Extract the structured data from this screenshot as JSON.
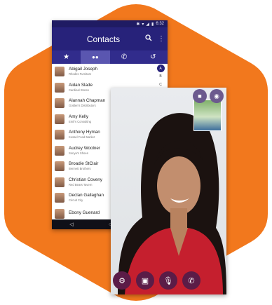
{
  "status": {
    "time": "6:32",
    "icons": [
      "bluetooth-icon",
      "wifi-icon",
      "signal-icon",
      "battery-icon"
    ]
  },
  "appbar": {
    "title": "Contacts",
    "search_icon": "search-icon",
    "menu_icon": "more-vert-icon"
  },
  "tabs": [
    {
      "icon": "star-icon",
      "glyph": "★"
    },
    {
      "icon": "contacts-icon",
      "glyph": "👥"
    },
    {
      "icon": "phone-icon",
      "glyph": "✆"
    },
    {
      "icon": "history-icon",
      "glyph": "↺"
    }
  ],
  "index_letters": [
    "A",
    "B",
    "C"
  ],
  "contacts": [
    {
      "name": "Abigail Joseph",
      "company": "Rhodes Furniture"
    },
    {
      "name": "Aidan Slade",
      "company": "Cardinal Stores"
    },
    {
      "name": "Alannah Chapman",
      "company": "Golden's Distributors"
    },
    {
      "name": "Amy Kelly",
      "company": "Emil's Consulting"
    },
    {
      "name": "Anthony Hyman",
      "company": "Kessel Food Market"
    },
    {
      "name": "Audrey Woolner",
      "company": "Sonya's Shoes"
    },
    {
      "name": "Broadie StClair",
      "company": "Bennett Brothers"
    },
    {
      "name": "Christian Coveny",
      "company": "Red Bears Tavern"
    },
    {
      "name": "Declan Gallaghan",
      "company": "Circuit City"
    },
    {
      "name": "Ebony Guenard",
      "company": ""
    }
  ],
  "video_call": {
    "top_buttons": [
      "video-camera-icon",
      "eye-icon"
    ],
    "controls": [
      "settings-icon",
      "dialpad-icon",
      "microphone-icon",
      "end-call-icon"
    ]
  },
  "colors": {
    "hexagon": "#f2781d",
    "appbar": "#27227a",
    "tabbar": "#312c8c",
    "call_button": "#5b1c47"
  }
}
